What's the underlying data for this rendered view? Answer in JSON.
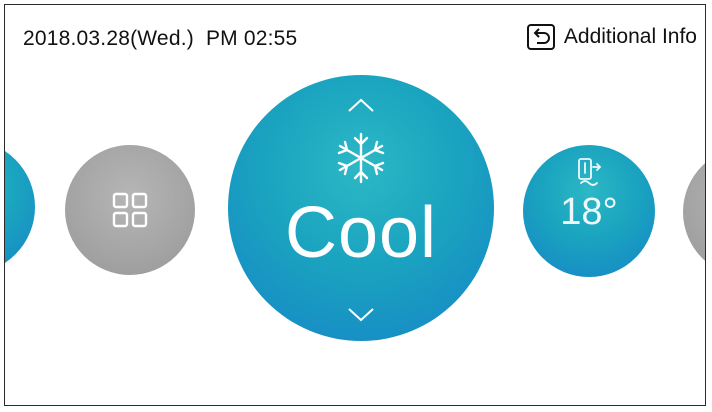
{
  "status_bar": {
    "date": "2018.03.28(Wed.)",
    "time": "PM 02:55",
    "additional_info_label": "Additional Info",
    "additional_info_icon": "return-arrow-icon"
  },
  "carousel": {
    "items": [
      {
        "name": "previous-mode-button",
        "color": "#1a9fd0",
        "partial": true
      },
      {
        "name": "menu-grid-button",
        "icon": "grid-icon",
        "color": "#a8a8a8"
      },
      {
        "name": "mode-dial",
        "icon": "snowflake-icon",
        "label": "Cool",
        "color": "#1ba4c0",
        "selected": true
      },
      {
        "name": "temperature-button",
        "icon": "humidity-sensor-icon",
        "value": "18°",
        "color": "#1b94d0"
      },
      {
        "name": "next-button",
        "color": "#a8a8a8",
        "partial": true
      }
    ],
    "mode_label": "Cool",
    "temperature": "18°"
  }
}
